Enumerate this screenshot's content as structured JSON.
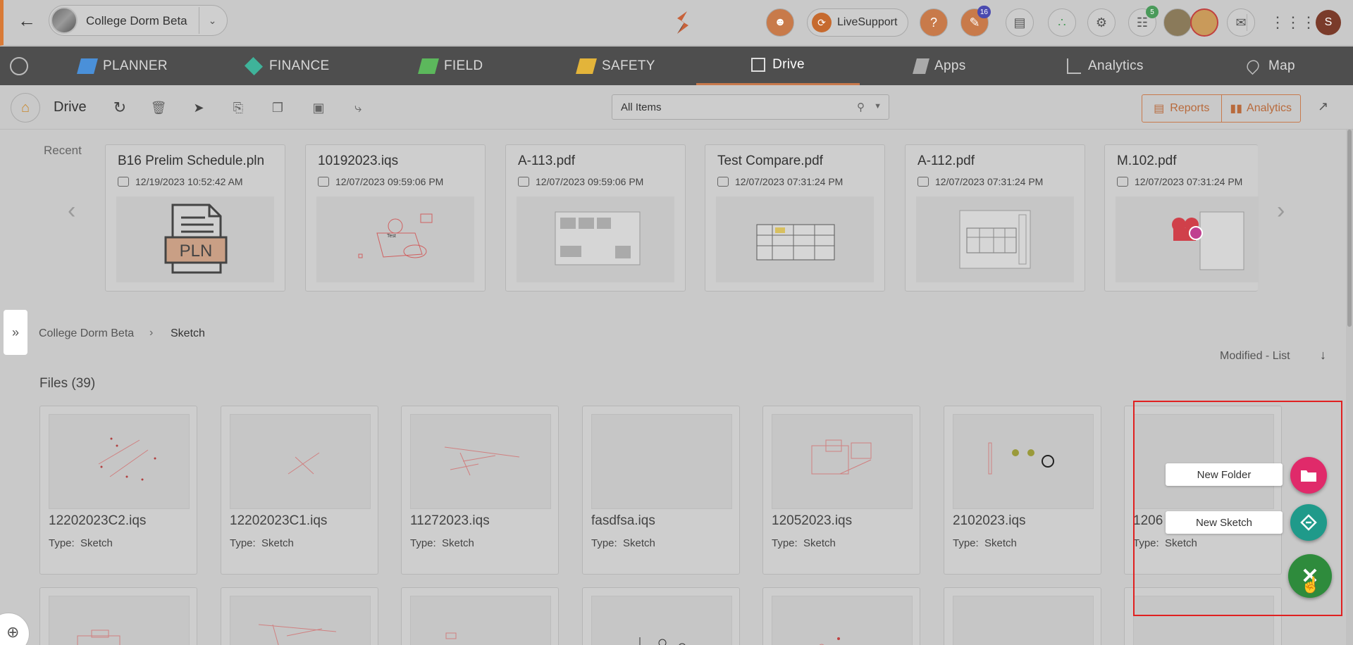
{
  "project": {
    "name": "College Dorm Beta"
  },
  "topbar": {
    "live_support": "LiveSupport",
    "notifications_badge": "16",
    "cart_badge": "5",
    "user_initial": "S"
  },
  "modules": [
    {
      "label": "PLANNER",
      "icon": "planner-icon",
      "color": "#4a90d9"
    },
    {
      "label": "FINANCE",
      "icon": "finance-icon",
      "color": "#3fb39a"
    },
    {
      "label": "FIELD",
      "icon": "field-icon",
      "color": "#5cb85c"
    },
    {
      "label": "SAFETY",
      "icon": "safety-icon",
      "color": "#e3b43a"
    },
    {
      "label": "Drive",
      "icon": "drive-icon",
      "color": "#dddddd"
    },
    {
      "label": "Apps",
      "icon": "apps-icon",
      "color": "#bbbbbb"
    },
    {
      "label": "Analytics",
      "icon": "analytics-icon",
      "color": "#bbbbbb"
    },
    {
      "label": "Map",
      "icon": "map-icon",
      "color": "#bbbbbb"
    }
  ],
  "toolbar": {
    "title": "Drive",
    "filter_value": "All Items",
    "reports_label": "Reports",
    "analytics_label": "Analytics"
  },
  "recent": {
    "label": "Recent",
    "items": [
      {
        "name": "B16 Prelim Schedule.pln",
        "date": "12/19/2023 10:52:42 AM"
      },
      {
        "name": "10192023.iqs",
        "date": "12/07/2023 09:59:06 PM"
      },
      {
        "name": "A-113.pdf",
        "date": "12/07/2023 09:59:06 PM"
      },
      {
        "name": "Test Compare.pdf",
        "date": "12/07/2023 07:31:24 PM"
      },
      {
        "name": "A-112.pdf",
        "date": "12/07/2023 07:31:24 PM"
      },
      {
        "name": "M.102.pdf",
        "date": "12/07/2023 07:31:24 PM"
      }
    ],
    "pln_badge": "PLN",
    "sketch_text": "Test"
  },
  "breadcrumb": {
    "root": "College Dorm Beta",
    "current": "Sketch"
  },
  "sort": {
    "label": "Modified - List"
  },
  "files": {
    "title": "Files (39)",
    "type_label": "Type:",
    "items": [
      {
        "name": "12202023C2.iqs",
        "type": "Sketch"
      },
      {
        "name": "12202023C1.iqs",
        "type": "Sketch"
      },
      {
        "name": "11272023.iqs",
        "type": "Sketch"
      },
      {
        "name": "fasdfsa.iqs",
        "type": "Sketch"
      },
      {
        "name": "12052023.iqs",
        "type": "Sketch"
      },
      {
        "name": "2102023.iqs",
        "type": "Sketch"
      },
      {
        "name": "1206",
        "type": "Sketch"
      }
    ]
  },
  "fab": {
    "new_folder": "New Folder",
    "new_sketch": "New Sketch"
  }
}
